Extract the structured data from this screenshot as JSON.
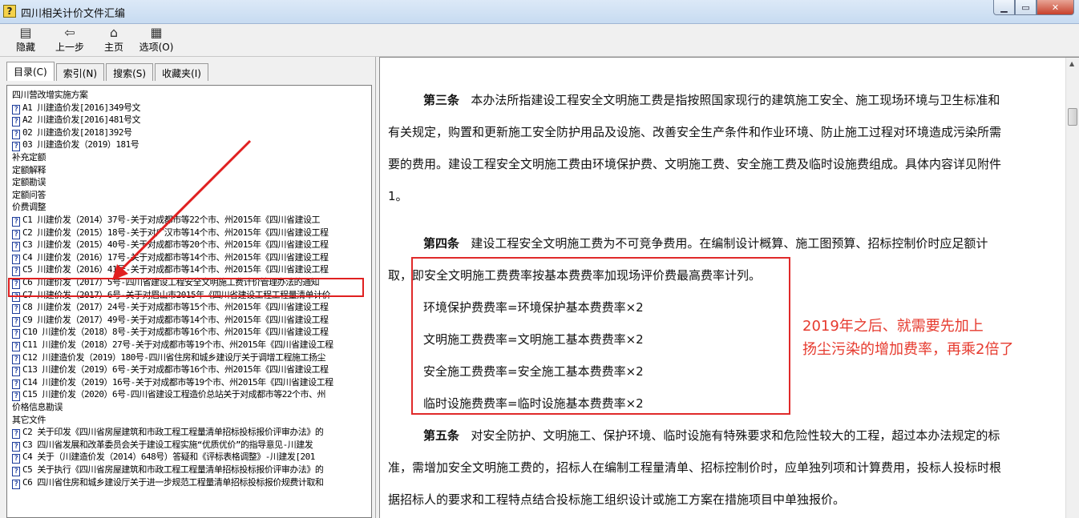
{
  "window": {
    "title": "四川相关计价文件汇编",
    "icon": "help-file-icon"
  },
  "toolbar": {
    "hide_label": "隐藏",
    "back_label": "上一步",
    "home_label": "主页",
    "options_label": "选项(O)"
  },
  "tabs": [
    "目录(C)",
    "索引(N)",
    "搜索(S)",
    "收藏夹(I)"
  ],
  "tree": [
    {
      "text": "四川营改增实施方案",
      "icon": false
    },
    {
      "text": "A1 川建造价发[2016]349号文",
      "icon": true
    },
    {
      "text": "A2 川建造价发[2016]481号文",
      "icon": true
    },
    {
      "text": "02 川建造价发[2018]392号",
      "icon": true
    },
    {
      "text": "03 川建造价发（2019）181号",
      "icon": true
    },
    {
      "text": "补充定额",
      "icon": false
    },
    {
      "text": "定额解释",
      "icon": false
    },
    {
      "text": "定额勘误",
      "icon": false
    },
    {
      "text": "定额问答",
      "icon": false
    },
    {
      "text": "价费调整",
      "icon": false
    },
    {
      "text": "C1 川建价发（2014）37号-关于对成都市等22个市、州2015年《四川省建设工",
      "icon": true
    },
    {
      "text": "C2 川建价发（2015）18号-关于对广汉市等14个市、州2015年《四川省建设工程",
      "icon": true
    },
    {
      "text": "C3 川建价发（2015）40号-关于对成都市等20个市、州2015年《四川省建设工程",
      "icon": true
    },
    {
      "text": "C4 川建价发（2016）17号-关于对成都市等14个市、州2015年《四川省建设工程",
      "icon": true
    },
    {
      "text": "C5 川建价发（2016）41号-关于对成都市等14个市、州2015年《四川省建设工程",
      "icon": true
    },
    {
      "text": "C6 川建价发（2017）5号-四川省建设工程安全文明施工费计价管理办法的通知",
      "icon": true
    },
    {
      "text": "C7 川建价发（2017）6号-关于对眉山市2015年《四川省建设工程工程量清单计价",
      "icon": true
    },
    {
      "text": "C8 川建价发（2017）24号-关于对成都市等15个市、州2015年《四川省建设工程",
      "icon": true
    },
    {
      "text": "C9 川建价发（2017）49号-关于对成都市等14个市、州2015年《四川省建设工程",
      "icon": true
    },
    {
      "text": "C10 川建价发（2018）8号-关于对成都市等16个市、州2015年《四川省建设工程",
      "icon": true
    },
    {
      "text": "C11 川建价发（2018）27号-关于对成都市等19个市、州2015年《四川省建设工程",
      "icon": true
    },
    {
      "text": "C12 川建造价发（2019）180号-四川省住房和城乡建设厅关于调增工程施工扬尘",
      "icon": true
    },
    {
      "text": "C13 川建价发（2019）6号-关于对成都市等16个市、州2015年《四川省建设工程",
      "icon": true
    },
    {
      "text": "C14 川建价发（2019）16号-关于对成都市等19个市、州2015年《四川省建设工程",
      "icon": true
    },
    {
      "text": "C15 川建价发（2020）6号-四川省建设工程造价总站关于对成都市等22个市、州",
      "icon": true
    },
    {
      "text": "价格信息勘误",
      "icon": false
    },
    {
      "text": "其它文件",
      "icon": false
    },
    {
      "text": "C2 关于印发《四川省房屋建筑和市政工程工程量清单招标投标报价评审办法》的",
      "icon": true
    },
    {
      "text": "C3 四川省发展和改革委员会关于建设工程实施“优质优价”的指导意见-川建发",
      "icon": true
    },
    {
      "text": "C4 关于（川建造价发（2014）648号）答疑和《评标表格调整》-川建发[201",
      "icon": true
    },
    {
      "text": "C5 关于执行《四川省房屋建筑和市政工程工程量清单招标投标报价评审办法》的",
      "icon": true
    },
    {
      "text": "C6 四川省住房和城乡建设厅关于进一步规范工程量清单招标投标报价规费计取和",
      "icon": true
    }
  ],
  "document": {
    "art3_title": "第三条",
    "art3_l1": "本办法所指建设工程安全文明施工费是指按照国家现行的建筑施工安全、施工现场环境与卫生标准和",
    "art3_l2": "有关规定，购置和更新施工安全防护用品及设施、改善安全生产条件和作业环境、防止施工过程对环境造成污染所需",
    "art3_l3": "要的费用。建设工程安全文明施工费由环境保护费、文明施工费、安全施工费及临时设施费组成。具体内容详见附件",
    "art3_l4": "1。",
    "art4_title": "第四条",
    "art4_l1": "建设工程安全文明施工费为不可竞争费用。在编制设计概算、施工图预算、招标控制价时应足额计",
    "art4_l2": "取，即安全文明施工费费率按基本费费率加现场评价费最高费率计列。",
    "rate1": "环境保护费费率=环境保护基本费费率×2",
    "rate2": "文明施工费费率=文明施工基本费费率×2",
    "rate3": "安全施工费费率=安全施工基本费费率×2",
    "rate4": "临时设施费费率=临时设施基本费费率×2",
    "art5_title": "第五条",
    "art5_l1": "对安全防护、文明施工、保护环境、临时设施有特殊要求和危险性较大的工程，超过本办法规定的标",
    "art5_l2": "准，需增加安全文明施工费的，招标人在编制工程量清单、招标控制价时，应单独列项和计算费用，投标人投标时根",
    "art5_l3": "据招标人的要求和工程特点结合投标施工组织设计或施工方案在措施项目中单独报价。"
  },
  "annotation": {
    "line1": "2019年之后、就需要先加上",
    "line2": "扬尘污染的增加费率，再乘2倍了"
  },
  "colors": {
    "highlight": "#e02020",
    "note": "#e63a2e"
  }
}
